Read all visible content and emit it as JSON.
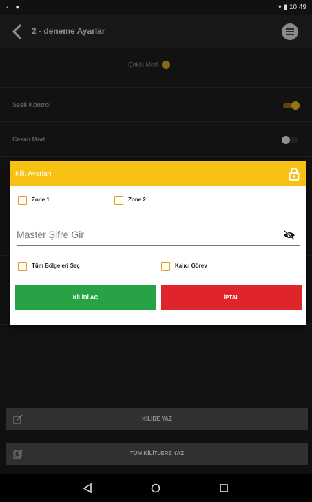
{
  "status_bar": {
    "time": "10:49"
  },
  "app_bar": {
    "title": "2 - deneme Ayarlar"
  },
  "settings": {
    "mode_label": "Çoklu Mod",
    "rows": [
      {
        "label": "Sesli Kontrol",
        "state": "on"
      },
      {
        "label": "Cezalı Mod",
        "state": "off"
      }
    ]
  },
  "bottom_actions": {
    "write_lock": "KİLİDE YAZ",
    "write_all": "TÜM KİLİTLERE YAZ"
  },
  "dialog": {
    "title": "Kilit Ayarları",
    "zones": [
      "Zone 1",
      "Zone 2"
    ],
    "password_placeholder": "Master Şifre Gir",
    "options": [
      "Tüm Bölgeleri Seç",
      "Kalıcı Görev"
    ],
    "unlock_label": "KİLİDİ AÇ",
    "cancel_label": "İPTAL"
  },
  "colors": {
    "accent": "#f7c114",
    "unlock_button": "#27a345",
    "cancel_button": "#e0242b",
    "toggle_on": "#e8b21f"
  },
  "icons": [
    "back-icon",
    "menu-icon",
    "lock-icon",
    "eye-off-icon",
    "edit-icon",
    "edit-all-icon",
    "nav-back-icon",
    "nav-home-icon",
    "nav-recents-icon"
  ]
}
